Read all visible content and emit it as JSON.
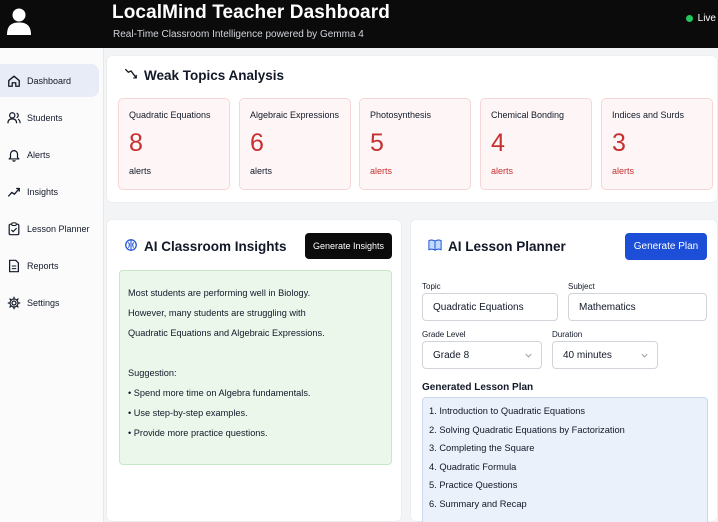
{
  "header": {
    "title": "LocalMind Teacher Dashboard",
    "subtitle": "Real-Time Classroom Intelligence powered by Gemma 4",
    "status": "Live"
  },
  "sidebar": {
    "items": [
      {
        "label": "Dashboard",
        "icon": "home-icon",
        "active": true
      },
      {
        "label": "Students",
        "icon": "users-icon"
      },
      {
        "label": "Alerts",
        "icon": "bell-icon"
      },
      {
        "label": "Insights",
        "icon": "trend-icon"
      },
      {
        "label": "Lesson Planner",
        "icon": "clipboard-icon"
      },
      {
        "label": "Reports",
        "icon": "document-icon"
      },
      {
        "label": "Settings",
        "icon": "gear-icon"
      }
    ]
  },
  "weak_topics": {
    "title": "Weak Topics Analysis",
    "cards": [
      {
        "name": "Quadratic Equations",
        "count": "8",
        "unit": "alerts"
      },
      {
        "name": "Algebraic Expressions",
        "count": "6",
        "unit": "alerts"
      },
      {
        "name": "Photosynthesis",
        "count": "5",
        "unit": "alerts"
      },
      {
        "name": "Chemical Bonding",
        "count": "4",
        "unit": "alerts"
      },
      {
        "name": "Indices and Surds",
        "count": "3",
        "unit": "alerts"
      }
    ]
  },
  "insights": {
    "title": "AI Classroom Insights",
    "button": "Generate Insights",
    "lines": [
      "Most students are performing well in Biology.",
      "However, many students are struggling with",
      "Quadratic Equations and Algebraic Expressions.",
      "",
      "Suggestion:",
      "• Spend more time on Algebra fundamentals.",
      "• Use step-by-step examples.",
      "• Provide more practice questions."
    ]
  },
  "planner": {
    "title": "AI Lesson Planner",
    "button": "Generate Plan",
    "topic_label": "Topic",
    "topic_value": "Quadratic Equations",
    "subject_label": "Subject",
    "subject_value": "Mathematics",
    "grade_label": "Grade Level",
    "grade_value": "Grade 8",
    "duration_label": "Duration",
    "duration_value": "40 minutes",
    "generated_title": "Generated Lesson Plan",
    "plan_items": [
      "1. Introduction to Quadratic Equations",
      "2. Solving Quadratic Equations by Factorization",
      "3. Completing the Square",
      "4. Quadratic Formula",
      "5. Practice Questions",
      "6. Summary and Recap"
    ]
  },
  "colors": {
    "accent_blue": "#1d4ed8",
    "alert_red": "#c53030",
    "live_green": "#22c55e"
  }
}
